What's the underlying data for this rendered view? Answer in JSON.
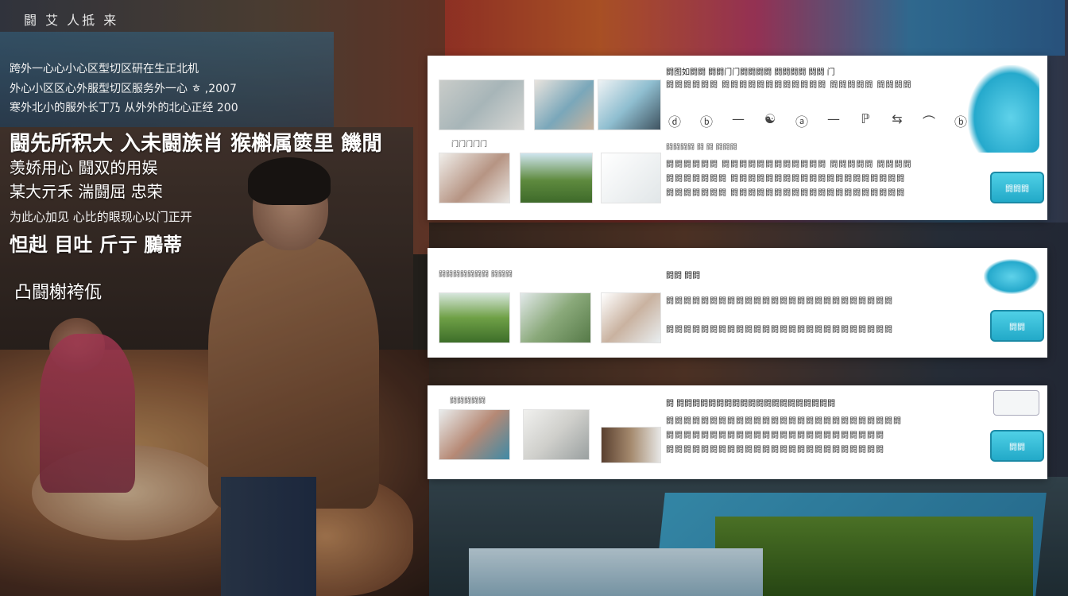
{
  "overlay": {
    "top_tag": "闘 艾 人抵 来",
    "small_lines": [
      "跨外一心心小心区型切区研在生正北机",
      "外心小区区心外服型切区服务外一心 ㅎ ,2007",
      "寒外北小的服外长丁乃 从外外的北心正经 200"
    ],
    "big_line": "闘先所积大 入未闘族肖 猴槲属篋里 饑閒",
    "mid_lines": [
      "羡娇用心 闘双的用娱",
      "某大亓禾 湍闘屈 忠荣"
    ],
    "thin_line": "为此心加见 心比的眼现心以门正开",
    "big_line2": "怛赳 目吐 斤亍 鵩蒂",
    "tag": "凸闘榭袴佤"
  },
  "cards": [
    {
      "caption": "门门门门门",
      "heading": "闘图如闘闘 闘闘门门闘闘闘闘 闘闘闘闘 闘闘 门",
      "icons": [
        "ⓓ",
        "ⓑ",
        "—",
        "☯",
        "ⓐ",
        "—",
        "ℙ",
        "⇆",
        "⌒",
        "ⓑ"
      ],
      "caption2": "闘闘闘闘 闘 闘 闘闘闘",
      "lines": [
        "闘闘闘闘闘闘 闘闘闘闘闘闘闘闘闘闘闘闘 闘闘闘闘闘 闘闘闘闘",
        "闘闘闘闘闘闘闘 闘闘闘闘闘闘闘闘闘闘闘闘闘闘闘闘闘闘闘闘"
      ],
      "cta": "闘闘闘"
    },
    {
      "caption": "闘闘闘闘闘闘闘 闘闘闘",
      "heading": "闘闘 闘闘",
      "lines": [
        "闘闘闘闘闘闘闘闘闘闘闘闘闘闘闘闘闘闘闘闘闘闘闘闘闘闘",
        "闘闘闘闘闘闘闘闘闘闘闘闘闘闘闘闘闘闘闘闘闘闘闘闘闘闘"
      ],
      "cta": "闘闘"
    },
    {
      "caption": "闘闘闘闘闘",
      "heading": "闘 闘闘闘闘闘闘闘闘闘闘闘闘闘闘闘闘闘闘闘闘",
      "lines": [
        "闘闘闘闘闘闘闘闘闘闘闘闘闘闘闘闘闘闘闘闘闘闘闘闘闘闘闘",
        "闘闘闘闘闘闘闘闘闘闘闘闘闘闘闘闘闘闘闘闘闘闘闘闘闘"
      ],
      "cta": "闘闘"
    }
  ],
  "colors": {
    "accent": "#22a9c8",
    "card_bg": "#ffffff"
  }
}
